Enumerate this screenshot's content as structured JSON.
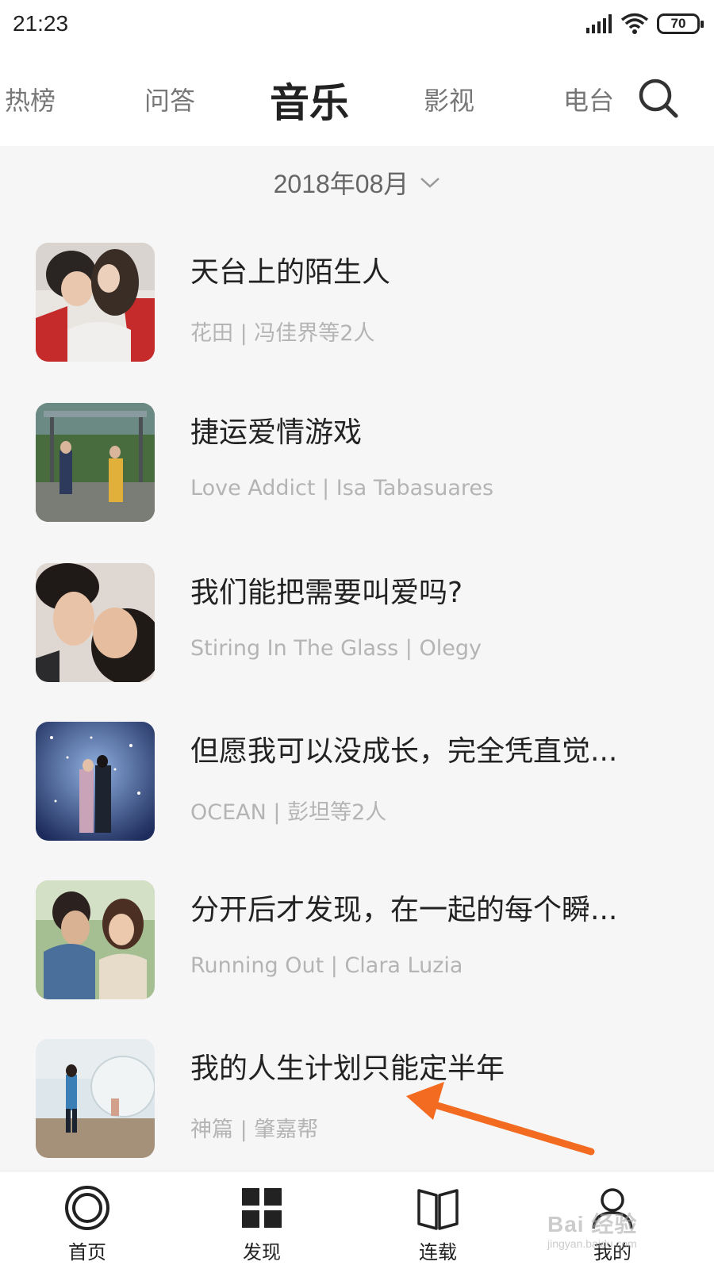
{
  "status_bar": {
    "time": "21:23",
    "battery": "70"
  },
  "top_tabs": [
    {
      "label": "热榜",
      "active": false
    },
    {
      "label": "问答",
      "active": false
    },
    {
      "label": "音乐",
      "active": true
    },
    {
      "label": "影视",
      "active": false
    },
    {
      "label": "电台",
      "active": false
    }
  ],
  "date_selector": {
    "label": "2018年08月"
  },
  "songs": [
    {
      "title": "天台上的陌生人",
      "meta": "花田 | 冯佳界等2人"
    },
    {
      "title": "捷运爱情游戏",
      "meta": "Love Addict | Isa Tabasuares"
    },
    {
      "title": "我们能把需要叫爱吗?",
      "meta": "Stiring In The Glass | Olegy"
    },
    {
      "title": "但愿我可以没成长，完全凭直觉...",
      "meta": "OCEAN | 彭坦等2人"
    },
    {
      "title": "分开后才发现，在一起的每个瞬...",
      "meta": "Running Out | Clara Luzia"
    },
    {
      "title": "我的人生计划只能定半年",
      "meta": "神篇 | 肇嘉帮"
    }
  ],
  "bottom_nav": [
    {
      "label": "首页",
      "icon": "home-circle-icon"
    },
    {
      "label": "发现",
      "icon": "grid-icon"
    },
    {
      "label": "连载",
      "icon": "book-icon"
    },
    {
      "label": "我的",
      "icon": "user-icon"
    }
  ],
  "watermark": {
    "brand": "Bai 经验",
    "url": "jingyan.baidu.com"
  },
  "colors": {
    "annotation_arrow": "#f26b21",
    "text_primary": "#222222",
    "text_secondary": "#b4b4b4"
  }
}
